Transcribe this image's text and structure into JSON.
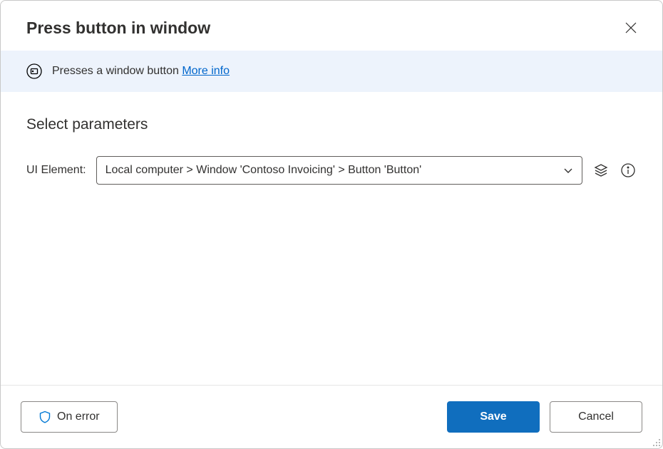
{
  "header": {
    "title": "Press button in window"
  },
  "banner": {
    "description": "Presses a window button",
    "more_info_label": "More info"
  },
  "parameters": {
    "section_title": "Select parameters",
    "ui_element": {
      "label": "UI Element:",
      "value": "Local computer > Window 'Contoso Invoicing' > Button 'Button'"
    }
  },
  "footer": {
    "on_error_label": "On error",
    "save_label": "Save",
    "cancel_label": "Cancel"
  }
}
